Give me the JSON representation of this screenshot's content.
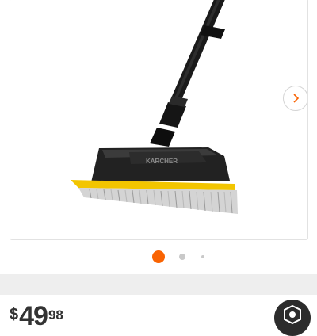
{
  "gallery": {
    "image_icon": "karcher-surface-brush-product-image",
    "next_icon": "chevron-right-icon",
    "slide_indicators": [
      {
        "state": "active",
        "color": "#f96302"
      },
      {
        "state": "inactive",
        "color": "#c9c9c9"
      },
      {
        "state": "inactive",
        "color": "#c9c9c9"
      }
    ],
    "product_brand_text": "KÄRCHER"
  },
  "price": {
    "currency": "$",
    "dollars": "49",
    "cents": "98"
  },
  "chat": {
    "icon": "chat-badge-icon",
    "color": "#2c2c2c"
  },
  "colors": {
    "accent": "#f96302",
    "brush_yellow": "#f2c500",
    "band": "#eeeeee"
  }
}
